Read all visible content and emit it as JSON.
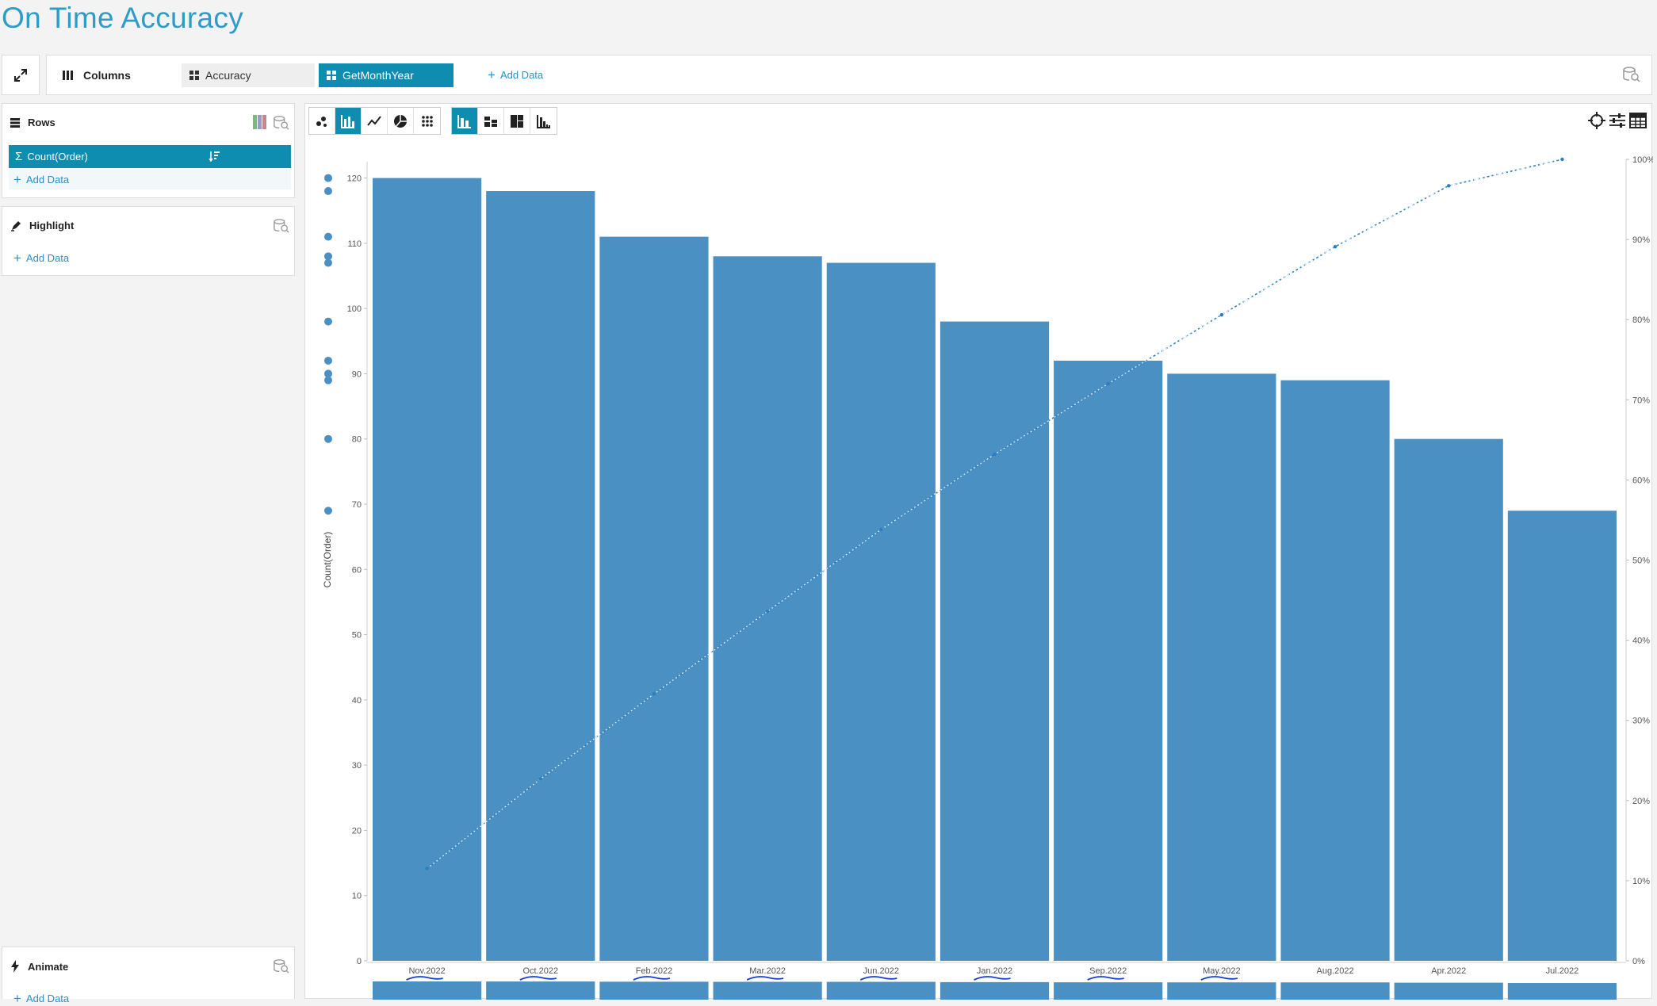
{
  "page": {
    "title": "On Time Accuracy"
  },
  "toolbar": {
    "columns_label": "Columns",
    "pills": [
      "Accuracy",
      "GetMonthYear"
    ],
    "add_data": "Add Data"
  },
  "rows_panel": {
    "title": "Rows",
    "field": "Count(Order)",
    "add_data": "Add Data"
  },
  "highlight_panel": {
    "title": "Highlight",
    "add_data": "Add Data"
  },
  "animate_panel": {
    "title": "Animate",
    "add_data": "Add Data"
  },
  "colors": {
    "accent": "#0e8db0",
    "bar": "#4a90c2",
    "title": "#2e9cc9",
    "annotation": "#1a3fd6"
  },
  "chart_data": {
    "type": "bar",
    "ylabel": "Count(Order)",
    "xlabel": "",
    "ylim": [
      0,
      120
    ],
    "y_ticks": [
      0,
      10,
      20,
      30,
      40,
      50,
      60,
      70,
      80,
      90,
      100,
      110,
      120
    ],
    "y2_ticks": [
      "0%",
      "10%",
      "20%",
      "30%",
      "40%",
      "50%",
      "60%",
      "70%",
      "80%",
      "90%",
      "100%"
    ],
    "categories": [
      "Nov.2022",
      "Oct.2022",
      "Feb.2022",
      "Mar.2022",
      "Jun.2022",
      "Jan.2022",
      "Sep.2022",
      "May.2022",
      "Aug.2022",
      "Apr.2022",
      "Jul.2022"
    ],
    "values": [
      120,
      118,
      111,
      108,
      107,
      98,
      92,
      90,
      89,
      80,
      69
    ],
    "cumulative_percent": [
      11.5,
      22.7,
      33.3,
      43.6,
      53.8,
      63.2,
      72.0,
      80.6,
      89.1,
      96.7,
      100
    ],
    "grid": false,
    "underlined_categories": [
      "Nov.2022",
      "Oct.2022",
      "Feb.2022",
      "Mar.2022",
      "Jun.2022",
      "Jan.2022",
      "Sep.2022",
      "May.2022"
    ]
  }
}
